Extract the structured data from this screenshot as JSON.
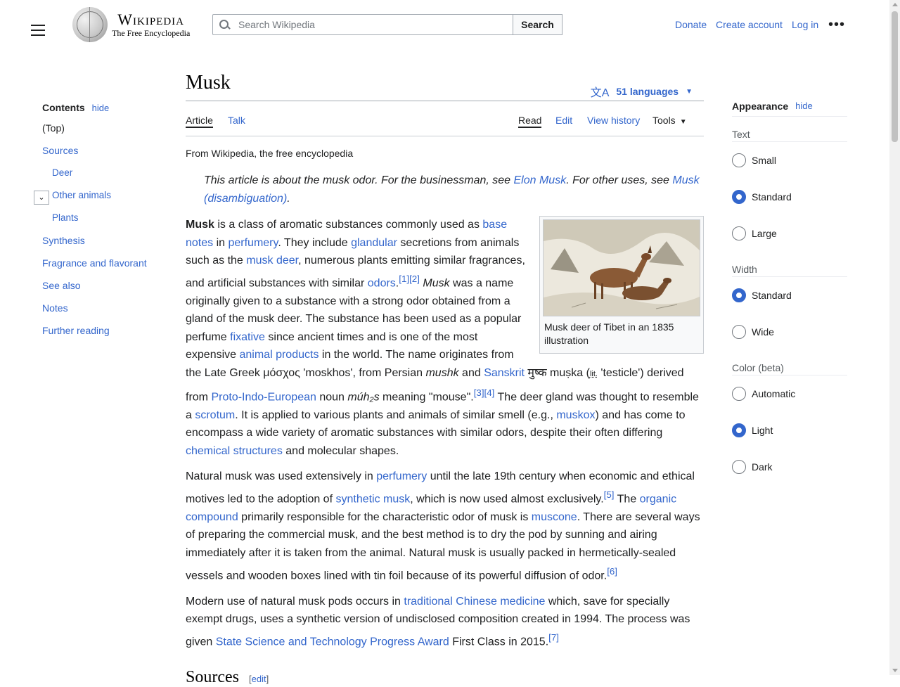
{
  "header": {
    "wordmark": "Wikipedia",
    "tagline": "The Free Encyclopedia",
    "search_placeholder": "Search Wikipedia",
    "search_button": "Search",
    "donate": "Donate",
    "create_account": "Create account",
    "login": "Log in",
    "more": "•••"
  },
  "toc": {
    "title": "Contents",
    "hide": "hide",
    "toggle": "⌄",
    "items": [
      {
        "label": "(Top)",
        "level": 1
      },
      {
        "label": "Sources",
        "level": 1
      },
      {
        "label": "Deer",
        "level": 2
      },
      {
        "label": "Other animals",
        "level": 2
      },
      {
        "label": "Plants",
        "level": 2
      },
      {
        "label": "Synthesis",
        "level": 1
      },
      {
        "label": "Fragrance and flavorant",
        "level": 1
      },
      {
        "label": "See also",
        "level": 1
      },
      {
        "label": "Notes",
        "level": 1
      },
      {
        "label": "Further reading",
        "level": 1
      }
    ]
  },
  "article": {
    "title": "Musk",
    "languages": "51 languages",
    "tabs": {
      "article": "Article",
      "talk": "Talk",
      "read": "Read",
      "edit": "Edit",
      "history": "View history",
      "tools": "Tools"
    },
    "from": "From Wikipedia, the free encyclopedia",
    "hatnote": {
      "t1": "This article is about the musk odor. For the businessman, see ",
      "l1": "Elon Musk",
      "t2": ". For other uses, see ",
      "l2": "Musk (disambiguation)",
      "t3": "."
    },
    "figure_caption": "Musk deer of Tibet in an 1835 illustration",
    "p1": {
      "b": "Musk",
      "t1": " is a class of aromatic substances commonly used as ",
      "l1": "base notes",
      "t2": " in ",
      "l2": "perfumery",
      "t3": ". They include ",
      "l3": "glandular",
      "t4": " secretions from animals such as the ",
      "l4": "musk deer",
      "t5": ", numerous plants emitting similar fragrances, and artificial substances with similar ",
      "l5": "odors",
      "t6": ".",
      "sup1": "[1]",
      "sup2": "[2]",
      "i1": "Musk",
      "t7": " was a name originally given to a substance with a strong odor obtained from a gland of the musk deer. The substance has been used as a popular perfume ",
      "l6": "fixative",
      "t8": " since ancient times and is one of the most expensive ",
      "l7": "animal products",
      "t9": " in the world. The name originates from the Late Greek μόσχος 'moskhos', from Persian ",
      "i2": "mushk",
      "t10": " and ",
      "l8": "Sanskrit",
      "t11": " मुष्क muṣka (",
      "lit": "lit.",
      "t12": " 'testicle')",
      "t13": " derived from ",
      "l9": "Proto-Indo-European",
      "t14": " noun ",
      "i3": "múh₂s",
      "t15": " meaning \"mouse\".",
      "sup3": "[3]",
      "sup4": "[4]",
      "t16": " The deer gland was thought to resemble a ",
      "l10": "scrotum",
      "t17": ". It is applied to various plants and animals of similar smell (e.g., ",
      "l11": "muskox",
      "t18": ") and has come to encompass a wide variety of aromatic substances with similar odors, despite their often differing ",
      "l12": "chemical structures",
      "t19": " and molecular shapes."
    },
    "p2": {
      "t1": "Natural musk was used extensively in ",
      "l1": "perfumery",
      "t2": " until the late 19th century when economic and ethical motives led to the adoption of ",
      "l2": "synthetic musk",
      "t3": ", which is now used almost exclusively.",
      "sup1": "[5]",
      "t4": " The ",
      "l3": "organic compound",
      "t5": " primarily responsible for the characteristic odor of musk is ",
      "l4": "muscone",
      "t6": ". There are several ways of preparing the commercial musk, and the best method is to dry the pod by sunning and airing immediately after it is taken from the animal. Natural musk is usually packed in hermetically-sealed vessels and wooden boxes lined with tin foil because of its powerful diffusion of odor.",
      "sup2": "[6]"
    },
    "p3": {
      "t1": "Modern use of natural musk pods occurs in ",
      "l1": "traditional Chinese medicine",
      "t2": " which, save for specially exempt drugs, uses a synthetic version of undisclosed composition created in 1994. The process was given ",
      "l2": "State Science and Technology Progress Award",
      "t3": " First Class in 2015.",
      "sup1": "[7]"
    },
    "h_sources": "Sources",
    "edit_bracket_open": "[",
    "edit_label": "edit",
    "edit_bracket_close": "]"
  },
  "appearance": {
    "title": "Appearance",
    "hide": "hide",
    "text_section": "Text",
    "text_options": [
      "Small",
      "Standard",
      "Large"
    ],
    "text_selected": 1,
    "width_section": "Width",
    "width_options": [
      "Standard",
      "Wide"
    ],
    "width_selected": 0,
    "color_section": "Color (beta)",
    "color_options": [
      "Automatic",
      "Light",
      "Dark"
    ],
    "color_selected": 1
  },
  "colors": {
    "link": "#3366cc",
    "text": "#202122",
    "border": "#a2a9b1"
  }
}
